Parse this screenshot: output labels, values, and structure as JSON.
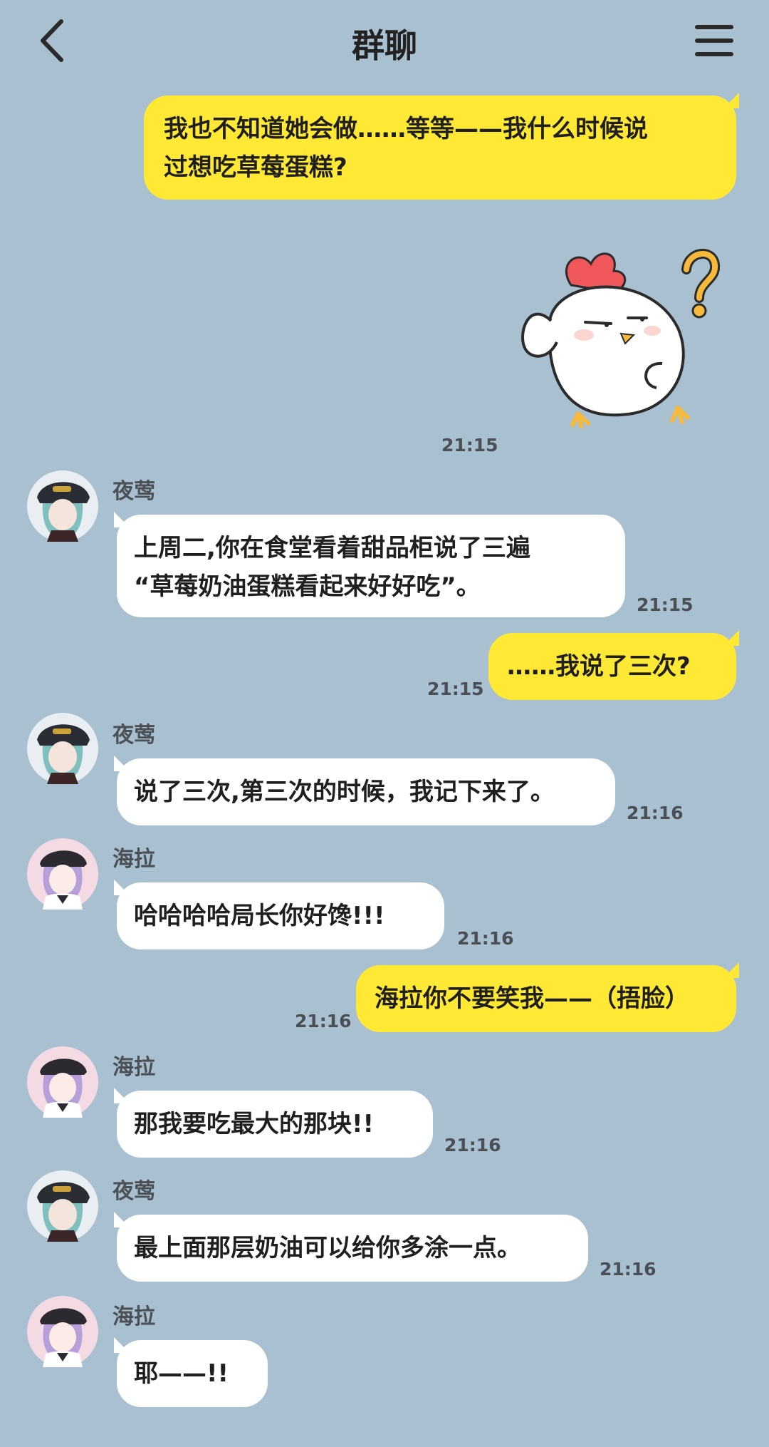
{
  "header": {
    "title": "群聊",
    "back_icon": "chevron-left-icon",
    "menu_icon": "hamburger-menu-icon"
  },
  "messages": [
    {
      "from": "me",
      "lines": [
        "我也不知道她会做……等等——我什么时候说",
        "过想吃草莓蛋糕?"
      ]
    },
    {
      "from": "me",
      "sticker": "chicken-question-sticker",
      "time": "21:15"
    },
    {
      "from": "夜莺",
      "lines": [
        "上周二,你在食堂看着甜品柜说了三遍",
        "“草莓奶油蛋糕看起来好好吃”。"
      ],
      "time": "21:15"
    },
    {
      "from": "me",
      "lines": [
        "……我说了三次?"
      ],
      "time": "21:15"
    },
    {
      "from": "夜莺",
      "lines": [
        "说了三次,第三次的时候，我记下来了。"
      ],
      "time": "21:16"
    },
    {
      "from": "海拉",
      "lines": [
        "哈哈哈哈局长你好馋!!!"
      ],
      "time": "21:16"
    },
    {
      "from": "me",
      "lines": [
        "海拉你不要笑我——（捂脸）"
      ],
      "time": "21:16"
    },
    {
      "from": "海拉",
      "lines": [
        "那我要吃最大的那块!!"
      ],
      "time": "21:16"
    },
    {
      "from": "夜莺",
      "lines": [
        "最上面那层奶油可以给你多涂一点。"
      ],
      "time": "21:16"
    },
    {
      "from": "海拉",
      "lines": [
        "耶——!!"
      ]
    }
  ],
  "colors": {
    "background": "#a9c0d1",
    "my_bubble": "#ffe934",
    "other_bubble": "#ffffff"
  }
}
